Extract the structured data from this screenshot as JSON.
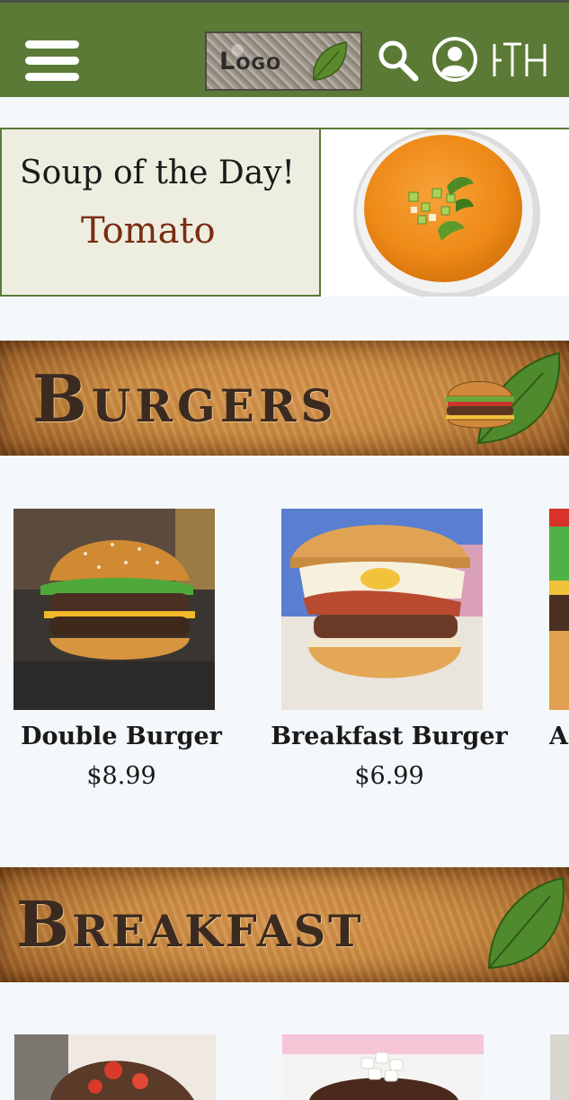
{
  "header": {
    "logo_text": "Logo",
    "icons": [
      "menu-icon",
      "search-icon",
      "account-icon",
      "locations-icon"
    ],
    "background": "#5b7a36"
  },
  "soup": {
    "title": "Soup of the Day!",
    "name": "Tomato"
  },
  "sections": {
    "burgers": "Burgers",
    "breakfast": "Breakfast"
  },
  "burgers": [
    {
      "name": "Double Burger",
      "price": "$8.99"
    },
    {
      "name": "Breakfast Burger",
      "price": "$6.99"
    },
    {
      "name": "A",
      "price": ""
    }
  ],
  "colors": {
    "accent_green": "#5b7a36",
    "soup_name": "#7b2d12",
    "banner_text": "#3b2a20"
  }
}
